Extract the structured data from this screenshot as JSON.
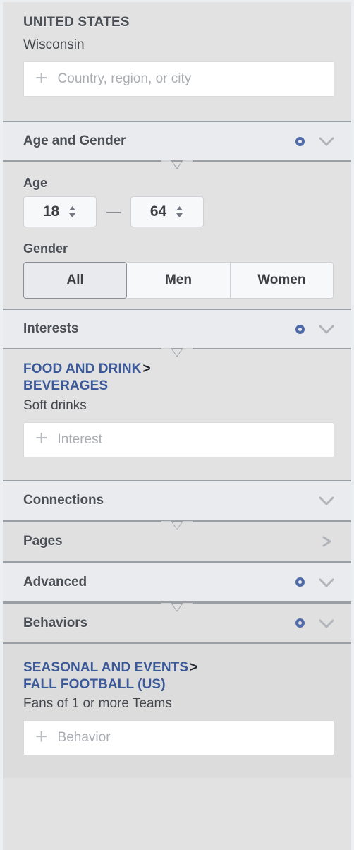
{
  "colors": {
    "accent_blue": "#3b5998",
    "ring_blue": "#4f6aa8",
    "header_bg": "#e9ebee",
    "content_bg": "#e2e2e2",
    "shaded_bg": "#dcdcdc",
    "border": "#9a9fa6",
    "text": "#4b4f56",
    "placeholder": "#a9acb1"
  },
  "location": {
    "country": "UNITED STATES",
    "region": "Wisconsin",
    "input_placeholder": "Country, region, or city",
    "add_icon": "plus-icon"
  },
  "sections": {
    "age_gender": {
      "title": "Age and Gender",
      "ring_icon": "ring-icon",
      "chevron_icon": "chevron-down-icon",
      "expanded": true
    },
    "interests": {
      "title": "Interests",
      "ring_icon": "ring-icon",
      "chevron_icon": "chevron-down-icon",
      "expanded": true
    },
    "connections": {
      "title": "Connections",
      "chevron_icon": "chevron-down-icon",
      "expanded": false
    },
    "pages": {
      "title": "Pages",
      "chevron_icon": "chevron-right-icon",
      "expanded": false
    },
    "advanced": {
      "title": "Advanced",
      "ring_icon": "ring-icon",
      "chevron_icon": "chevron-down-icon",
      "expanded": false
    },
    "behaviors": {
      "title": "Behaviors",
      "ring_icon": "ring-icon",
      "chevron_icon": "chevron-down-icon",
      "expanded": true
    }
  },
  "age": {
    "label": "Age",
    "min_value": "18",
    "max_value": "64",
    "separator": "—",
    "stepper_icon": "up-down-arrows-icon"
  },
  "gender": {
    "label": "Gender",
    "options": [
      {
        "label": "All",
        "selected": true
      },
      {
        "label": "Men",
        "selected": false
      },
      {
        "label": "Women",
        "selected": false
      }
    ]
  },
  "interests_content": {
    "breadcrumb_parent": "FOOD AND DRINK",
    "breadcrumb_sep": ">",
    "breadcrumb_child": "BEVERAGES",
    "selected_leaf": "Soft drinks",
    "input_placeholder": "Interest",
    "add_icon": "plus-icon"
  },
  "behaviors_content": {
    "breadcrumb_parent": "SEASONAL AND EVENTS",
    "breadcrumb_sep": ">",
    "breadcrumb_child": "FALL FOOTBALL (US)",
    "selected_leaf": "Fans of 1 or more Teams",
    "input_placeholder": "Behavior",
    "add_icon": "plus-icon"
  }
}
